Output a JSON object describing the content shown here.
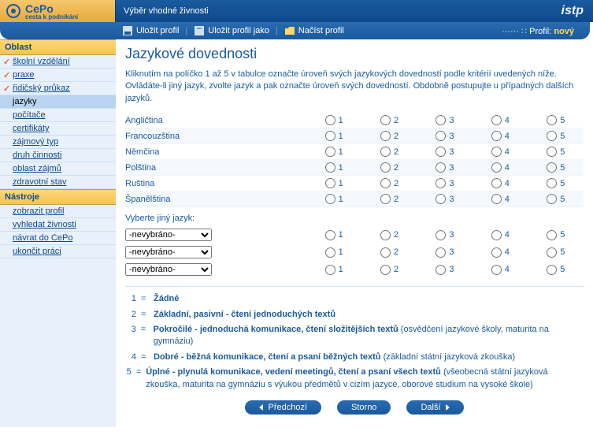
{
  "brand": {
    "name": "CePo",
    "sub": "cesta k podnikání"
  },
  "header": {
    "title": "Výběr vhodné živnosti",
    "istp": "istp"
  },
  "toolbar": {
    "save": "Uložit profil",
    "saveas": "Uložit profil jako",
    "load": "Načíst profil",
    "profile_label": "Profil:",
    "profile_value": "nový"
  },
  "sidebar": {
    "groups": [
      {
        "head": "Oblast",
        "items": [
          {
            "label": "školní vzdělání",
            "checked": true
          },
          {
            "label": "praxe",
            "checked": true
          },
          {
            "label": "řidičský průkaz",
            "checked": true
          },
          {
            "label": "jazyky",
            "active": true
          },
          {
            "label": "počítače"
          },
          {
            "label": "certifikáty"
          },
          {
            "label": "zájmový typ"
          },
          {
            "label": "druh činnosti"
          },
          {
            "label": "oblast zájmů"
          },
          {
            "label": "zdravotní stav"
          }
        ]
      },
      {
        "head": "Nástroje",
        "items": [
          {
            "label": "zobrazit profil"
          },
          {
            "label": "vyhledat živnosti"
          },
          {
            "label": "návrat do CePo"
          },
          {
            "label": "ukončit práci"
          }
        ]
      }
    ]
  },
  "page": {
    "title": "Jazykové dovednosti",
    "instr1": "Kliknutím na políčko 1 až 5 v tabulce označte úroveň svých jazykových dovedností podle kritérií uvedených níže.",
    "instr2": "Ovládáte-li jiný jazyk, zvolte jazyk a pak označte úroveň svých dovedností. Obdobně postupujte u případných dalších jazyků.",
    "languages": [
      "Angličtina",
      "Francouzština",
      "Němčina",
      "Polština",
      "Ruština",
      "Španělština"
    ],
    "scale": [
      "1",
      "2",
      "3",
      "4",
      "5"
    ],
    "other_label": "Vyberte jiný jazyk:",
    "other_placeholder": "-nevybráno-",
    "other_count": 3,
    "legend": [
      {
        "n": "1",
        "bold": "Žádné",
        "extra": ""
      },
      {
        "n": "2",
        "bold": "Základní, pasivní - čtení jednoduchých textů",
        "extra": ""
      },
      {
        "n": "3",
        "bold": "Pokročilé - jednoduchá komunikace, čtení složitějších textů",
        "extra": " (osvědčení jazykové školy, maturita na gymnáziu)"
      },
      {
        "n": "4",
        "bold": "Dobré - běžná komunikace, čtení a psaní běžných textů",
        "extra": " (základní státní jazyková zkouška)"
      },
      {
        "n": "5",
        "bold": "Úplné - plynulá komunikace, vedení meetingů, čtení a psaní všech textů",
        "extra": " (všeobecná státní jazyková zkouška, maturita na gymnáziu s výukou předmětů v cizím jazyce, oborové studium na vysoké škole)"
      }
    ],
    "buttons": {
      "prev": "Předchozí",
      "cancel": "Storno",
      "next": "Další"
    }
  }
}
